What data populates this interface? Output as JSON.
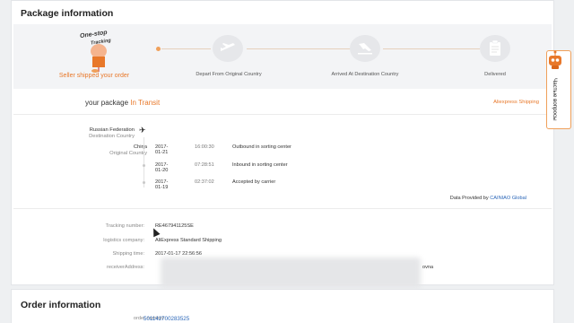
{
  "package": {
    "title": "Package information",
    "steps": [
      {
        "label": "Seller shipped your order",
        "icon": "package-balloon-icon",
        "active": true
      },
      {
        "label": "Depart From Original Country",
        "icon": "plane-takeoff-icon",
        "active": false
      },
      {
        "label": "Arrived At Destination Country",
        "icon": "plane-landing-icon",
        "active": false
      },
      {
        "label": "Delivered",
        "icon": "clipboard-icon",
        "active": false
      }
    ],
    "logo": {
      "line1": "One-stop",
      "line2": "Tracking"
    },
    "status_prefix": "your package ",
    "status": "In Transit",
    "provider_link": "Aliexpress Shipping",
    "destination": {
      "country": "Russian Federation",
      "label": "Destination Country"
    },
    "origin": {
      "country": "China",
      "label": "Original Country"
    },
    "events": [
      {
        "date": "2017-01-21",
        "time": "16:00:30",
        "message": "Outbound in sorting center"
      },
      {
        "date": "2017-01-20",
        "time": "07:28:51",
        "message": "Inbound in sorting center"
      },
      {
        "date": "2017-01-19",
        "time": "02:37:02",
        "message": "Accepted by carrier"
      }
    ],
    "data_provided_prefix": "Data Provided by ",
    "data_provided_by": "CAINIAO Global",
    "fields": [
      {
        "label": "Tracking number:",
        "value": "RE467941125SE"
      },
      {
        "label": "logistics company:",
        "value": "AliExpress Standard Shipping"
      },
      {
        "label": "Shipping time:",
        "value": "2017-01-17 22:56:56"
      },
      {
        "label": "receiverAddress:",
        "value": "ovna"
      }
    ]
  },
  "faq": {
    "label": "Частые вопросы"
  },
  "order": {
    "title": "Order information",
    "number_label": "order number:",
    "number_value": "501142700283525"
  },
  "colors": {
    "accent": "#e8782a",
    "link": "#2a66b8"
  }
}
